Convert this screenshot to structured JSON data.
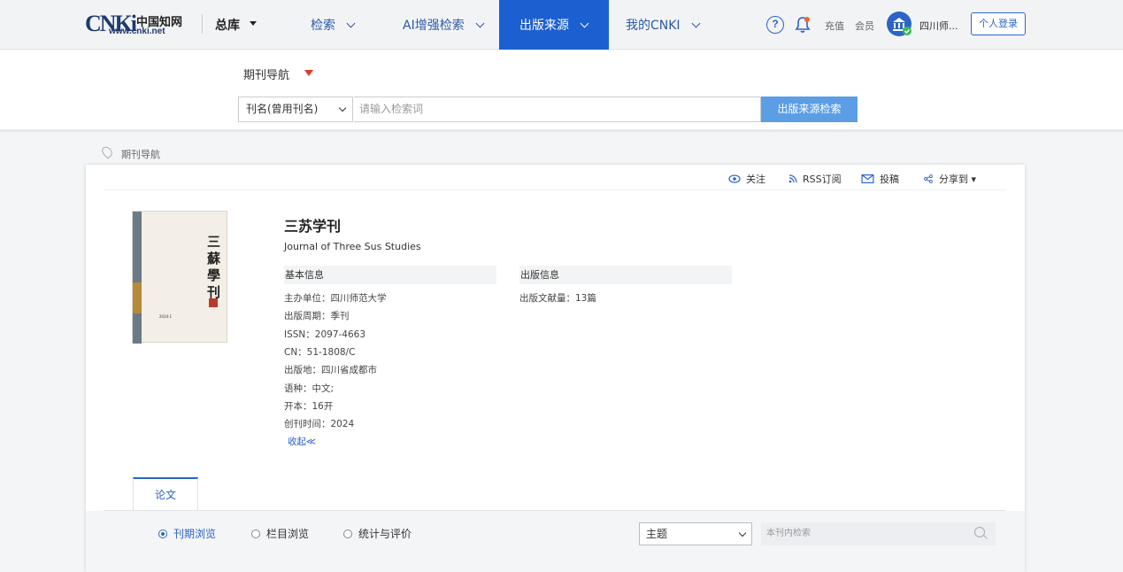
{
  "header": {
    "logo_text_c": "CNKi",
    "logo_text_cn": "中国知网",
    "logo_url": "www.cnki.net",
    "library": "总库",
    "nav": [
      {
        "label": "检索",
        "active": false
      },
      {
        "label": "AI增强检索",
        "active": false
      },
      {
        "label": "出版来源",
        "active": true
      },
      {
        "label": "我的CNKI",
        "active": false
      }
    ],
    "help_label": "?",
    "recharge": "充值",
    "member": "会员",
    "institution": "四川师...",
    "login": "个人登录"
  },
  "search": {
    "title": "期刊导航",
    "field_select": "刊名(曾用刊名)",
    "placeholder": "请输入检索词",
    "button": "出版来源检索"
  },
  "breadcrumb": "期刊导航",
  "toolbar": {
    "follow": "关注",
    "rss": "RSS订阅",
    "submit": "投稿",
    "share": "分享到 ▾"
  },
  "cover": {
    "title_chars": "三蘇學刊",
    "year_label": "2024·1"
  },
  "journal": {
    "title": "三苏学刊",
    "title_en": "Journal of Three Sus Studies",
    "basic_info_head": "基本信息",
    "publish_info_head": "出版信息",
    "basic_info": [
      "主办单位：四川师范大学",
      "出版周期：季刊",
      "ISSN：2097-4663",
      "CN：51-1808/C",
      "出版地：四川省成都市",
      "语种：中文;",
      "开本：16开",
      "创刊时间：2024"
    ],
    "publish_info": [
      "出版文献量：13篇"
    ],
    "collapse": "收起≪"
  },
  "tabs": {
    "papers": "论文"
  },
  "filter": {
    "options": [
      {
        "label": "刊期浏览",
        "selected": true
      },
      {
        "label": "栏目浏览",
        "selected": false
      },
      {
        "label": "统计与评价",
        "selected": false
      }
    ],
    "field": "主题",
    "placeholder": "本刊内检索"
  }
}
